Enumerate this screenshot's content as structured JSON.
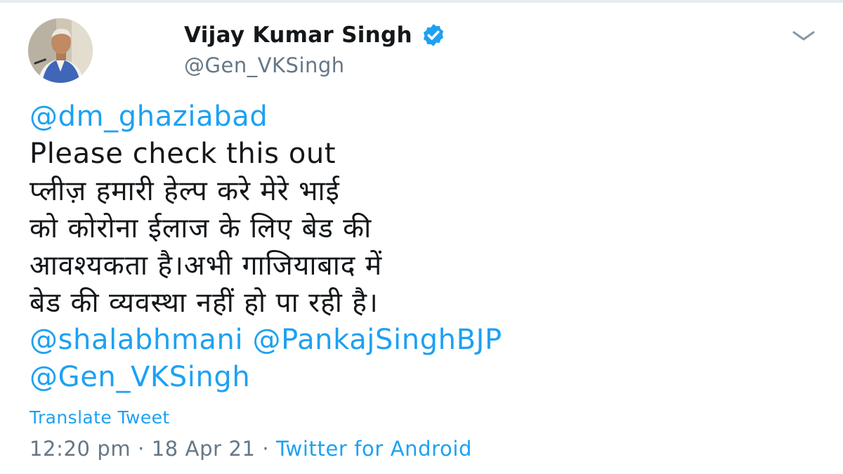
{
  "author": {
    "display_name": "Vijay Kumar Singh",
    "handle": "@Gen_VKSingh",
    "verified_icon": "verified-badge-icon",
    "avatar_icon": "profile-photo"
  },
  "menu_icon": "chevron-down-icon",
  "tweet": {
    "lines": [
      {
        "type": "mention",
        "text": "@dm_ghaziabad"
      },
      {
        "type": "text",
        "text": "Please check this out"
      },
      {
        "type": "hindi",
        "text": "प्लीज़ हमारी हेल्प करे मेरे भाई"
      },
      {
        "type": "hindi",
        "text": "को कोरोना ईलाज के लिए बेड की"
      },
      {
        "type": "hindi",
        "text": "आवश्यकता है।अभी गाजियाबाद में"
      },
      {
        "type": "hindi",
        "text": "बेड की व्यवस्था नहीं हो पा रही है।"
      }
    ],
    "mentions_line_1": [
      "@shalabhmani",
      "@PankajSinghBJP"
    ],
    "mentions_line_2": [
      "@Gen_VKSingh"
    ]
  },
  "translate_label": "Translate Tweet",
  "meta": {
    "time": "12:20 pm",
    "separator": "·",
    "date": "18 Apr 21",
    "source": "Twitter for Android"
  },
  "colors": {
    "link": "#1da1f2",
    "secondary_text": "#657786",
    "primary_text": "#14171a",
    "verified": "#1da1f2"
  }
}
